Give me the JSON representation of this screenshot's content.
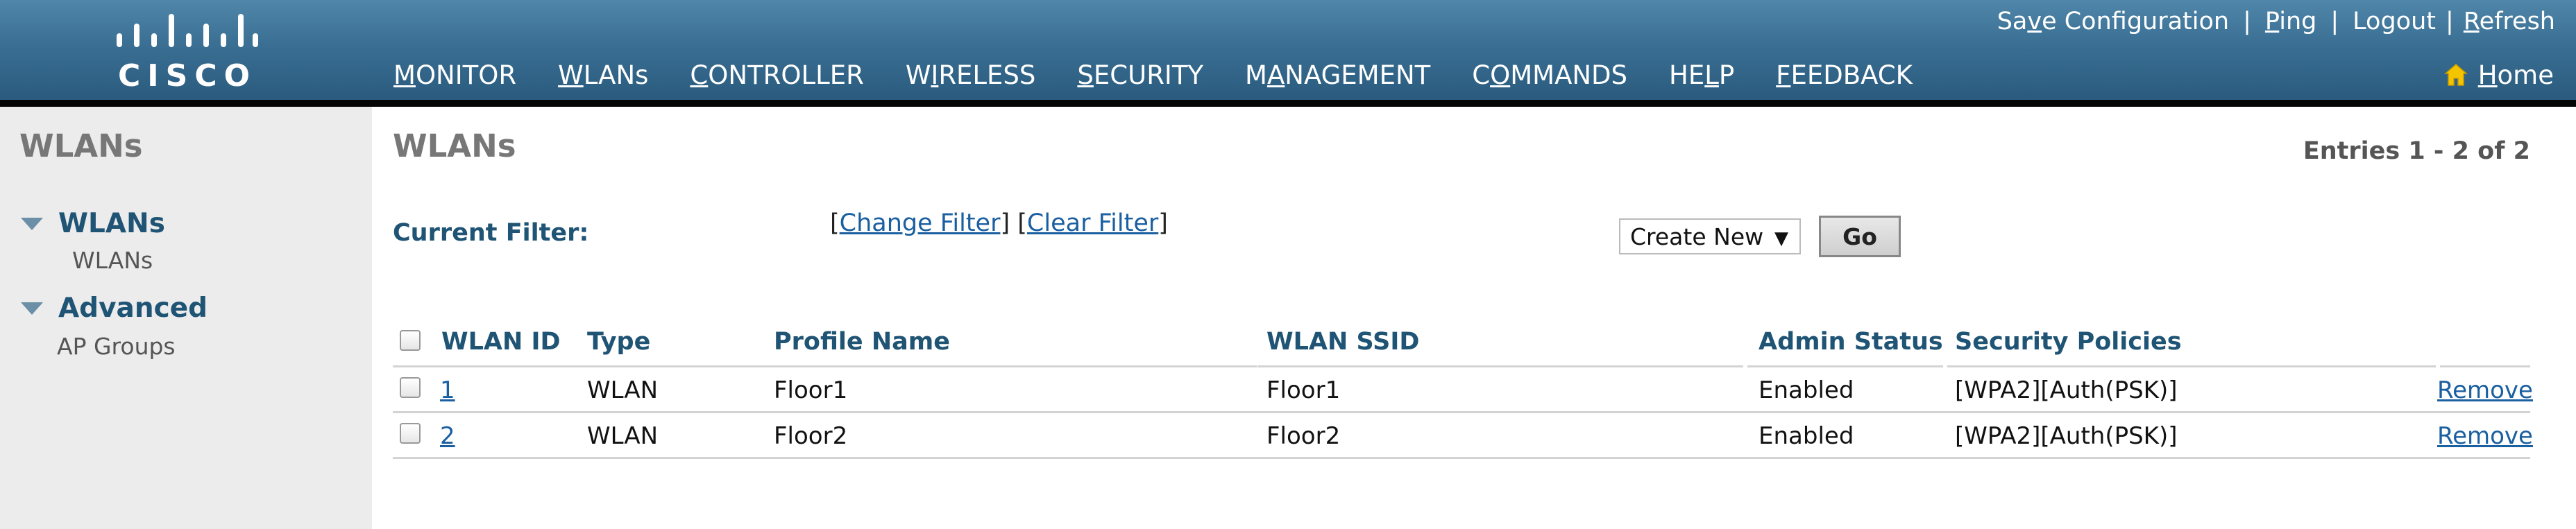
{
  "header": {
    "brand": "CISCO",
    "nav": [
      {
        "pre": "",
        "u": "M",
        "post": "ONITOR"
      },
      {
        "pre": "",
        "u": "W",
        "post": "LANs"
      },
      {
        "pre": "",
        "u": "C",
        "post": "ONTROLLER"
      },
      {
        "pre": "W",
        "u": "I",
        "post": "RELESS"
      },
      {
        "pre": "",
        "u": "S",
        "post": "ECURITY"
      },
      {
        "pre": "M",
        "u": "A",
        "post": "NAGEMENT"
      },
      {
        "pre": "C",
        "u": "O",
        "post": "MMANDS"
      },
      {
        "pre": "HE",
        "u": "L",
        "post": "P"
      },
      {
        "pre": "",
        "u": "F",
        "post": "EEDBACK"
      }
    ],
    "utility": {
      "save": {
        "pre": "Sa",
        "u": "v",
        "post": "e Configuration"
      },
      "ping": {
        "pre": "",
        "u": "P",
        "post": "ing"
      },
      "logout": {
        "pre": "",
        "u": "",
        "post": "Logout"
      },
      "refresh": {
        "pre": "",
        "u": "R",
        "post": "efresh"
      },
      "separator": "|"
    },
    "home": {
      "pre": "",
      "u": "H",
      "post": "ome"
    },
    "colors": {
      "header_top": "#4f86a9",
      "header_bottom": "#2a5b7e",
      "accent": "#1f5475",
      "home_icon": "#f5c400"
    }
  },
  "sidebar": {
    "title": "WLANs",
    "groups": [
      {
        "label": "WLANs",
        "items": [
          "WLANs"
        ]
      },
      {
        "label": "Advanced",
        "items": [
          "AP Groups"
        ]
      }
    ]
  },
  "main": {
    "title": "WLANs",
    "entries": "Entries 1 - 2 of 2",
    "filter": {
      "label": "Current Filter:",
      "change": "Change Filter",
      "clear": "Clear Filter",
      "open_bracket": "[",
      "close_bracket": "]"
    },
    "create_select": {
      "value": "Create New",
      "caret": "▼"
    },
    "go_button": "Go",
    "table": {
      "headers": [
        "WLAN ID",
        "Type",
        "Profile Name",
        "WLAN SSID",
        "Admin Status",
        "Security Policies"
      ],
      "rows": [
        {
          "id": "1",
          "type": "WLAN",
          "profile": "Floor1",
          "ssid": "Floor1",
          "status": "Enabled",
          "security": "[WPA2][Auth(PSK)]",
          "action": "Remove"
        },
        {
          "id": "2",
          "type": "WLAN",
          "profile": "Floor2",
          "ssid": "Floor2",
          "status": "Enabled",
          "security": "[WPA2][Auth(PSK)]",
          "action": "Remove"
        }
      ]
    }
  }
}
